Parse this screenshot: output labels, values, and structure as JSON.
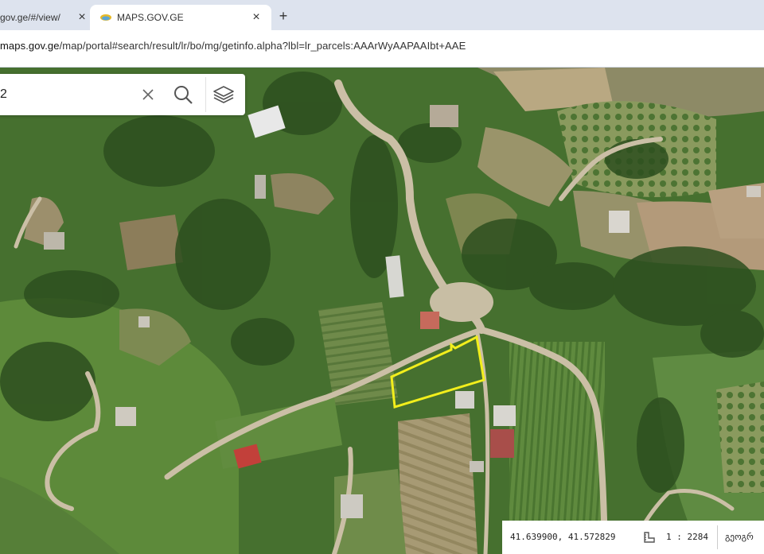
{
  "browser": {
    "tabs": [
      {
        "title": "gov.ge/#/view/"
      },
      {
        "title": "MAPS.GOV.GE"
      }
    ],
    "new_tab": "+",
    "close_glyph": "×",
    "url_host": "maps.gov.ge",
    "url_path": "/map/portal#search/result/lr/bo/mg/getinfo.alpha?lbl=lr_parcels:AAArWyAAPAAIbt+AAE"
  },
  "search": {
    "value": "2",
    "icons": [
      "close-icon",
      "search-icon",
      "layers-icon"
    ]
  },
  "status": {
    "coordinates": "41.639900, 41.572829",
    "scale": "1 : 2284",
    "language": "გეოგრ"
  },
  "colors": {
    "parcel_outline": "#f2ee1c",
    "vegetation": "#3f6b2d",
    "road": "#c9bfa8"
  }
}
